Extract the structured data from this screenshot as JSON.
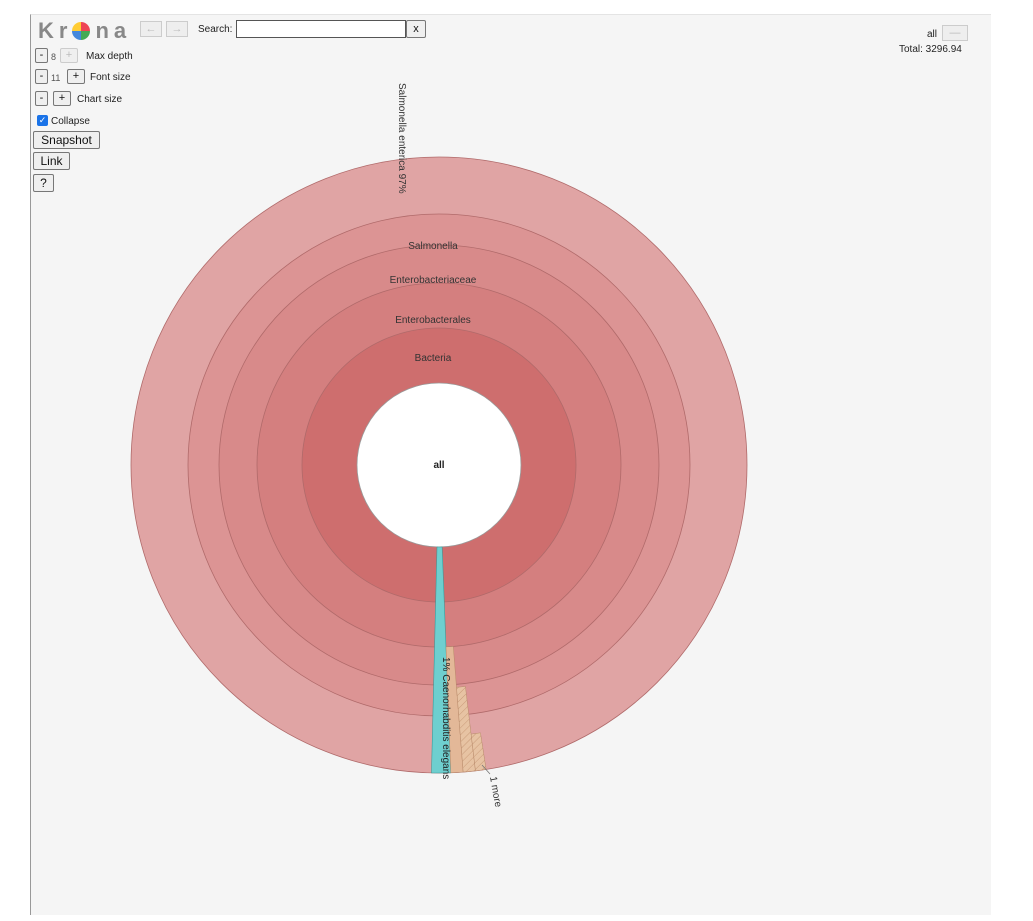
{
  "toolbar": {
    "logo_text": "Kr",
    "logo_text_end": "na",
    "back_icon": "back-arrow-icon",
    "forward_icon": "forward-arrow-icon",
    "search_label": "Search:",
    "search_value": "",
    "search_clear": "x"
  },
  "controls": {
    "minus": "-",
    "plus": "+",
    "max_depth_value": "8",
    "max_depth_label": "Max depth",
    "font_size_value": "11",
    "font_size_label": "Font size",
    "chart_size_label": "Chart size",
    "collapse_label": "Collapse",
    "collapse_checked": true,
    "snapshot": "Snapshot",
    "link": "Link",
    "help": "?"
  },
  "details": {
    "selected": "all",
    "total": "Total: 3296.94"
  },
  "colors": {
    "outer_ring": "#e0a4a4",
    "ring_genus": "#dc9494",
    "ring_family": "#d88a8a",
    "ring_order": "#d47f7f",
    "ring_kingdom": "#ce6e6e",
    "elegans": "#6ecfcf",
    "other": "#e3b898"
  },
  "chart_data": {
    "type": "sunburst",
    "center_label": "all",
    "rings": [
      {
        "label": "Bacteria"
      },
      {
        "label": "Enterobacterales"
      },
      {
        "label": "Enterobacteriaceae"
      },
      {
        "label": "Salmonella"
      },
      {
        "label": "Salmonella enterica",
        "percent": "97%"
      }
    ],
    "wedges": [
      {
        "label": "Caenorhabditis elegans",
        "percent": "1%"
      },
      {
        "label": "1 more"
      }
    ]
  }
}
